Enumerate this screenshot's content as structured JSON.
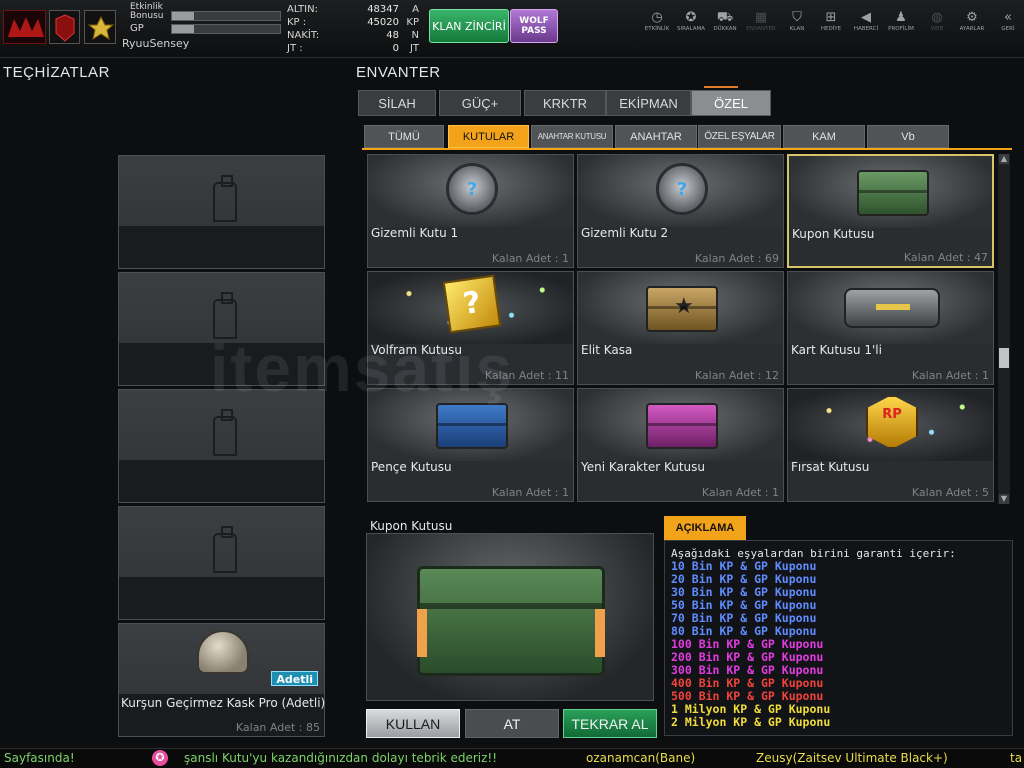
{
  "header": {
    "bonus_label": "Etkinlik Bonusu",
    "gp_label": "GP",
    "username": "RyuuSensey",
    "bonus_progress": 0.2,
    "gp_progress": 0.2,
    "currencies": [
      {
        "label": "ALTIN:",
        "value": "48347",
        "unit": "A"
      },
      {
        "label": "KP   :",
        "value": "45020",
        "unit": "KP"
      },
      {
        "label": "NAKİT:",
        "value": "48",
        "unit": "N"
      },
      {
        "label": "JT   :",
        "value": "0",
        "unit": "JT"
      }
    ],
    "klan_button": "KLAN ZİNCİRİ",
    "wolf_button": "WOLF PASS",
    "nav": [
      {
        "label": "ETKİNLİK",
        "icon": "clock-icon",
        "glyph": "◷"
      },
      {
        "label": "SIRALAMA",
        "icon": "medal-icon",
        "glyph": "✪"
      },
      {
        "label": "DÜKKAN",
        "icon": "cart-icon",
        "glyph": "⛟"
      },
      {
        "label": "ENVANTER",
        "icon": "inventory-icon",
        "glyph": "▦",
        "dim": true
      },
      {
        "label": "KLAN",
        "icon": "shield-icon",
        "glyph": "⛉"
      },
      {
        "label": "HEDİYE",
        "icon": "gift-icon",
        "glyph": "⊞"
      },
      {
        "label": "HABERCİ",
        "icon": "megaphone-icon",
        "glyph": "◀"
      },
      {
        "label": "PROFİLİM",
        "icon": "profile-icon",
        "glyph": "♟"
      },
      {
        "label": "WEB",
        "icon": "globe-icon",
        "glyph": "◍",
        "dim": true
      },
      {
        "label": "AYARLAR",
        "icon": "gear-icon",
        "glyph": "⚙"
      },
      {
        "label": "GERİ",
        "icon": "back-icon",
        "glyph": "«"
      }
    ]
  },
  "left": {
    "title": "TEÇHİZATLAR",
    "slots": [
      {
        "name": "",
        "count": ""
      },
      {
        "name": "",
        "count": ""
      },
      {
        "name": "",
        "count": ""
      },
      {
        "name": "",
        "count": ""
      },
      {
        "name": "Kurşun Geçirmez Kask Pro (Adetli)",
        "count": "Kalan Adet : 85",
        "badge": "Adetli"
      }
    ]
  },
  "inventory": {
    "title": "ENVANTER",
    "tabs": [
      "SİLAH",
      "GÜÇ+",
      "KRKTR",
      "EKİPMAN",
      "ÖZEL"
    ],
    "active_tab": 4,
    "subtabs": [
      "TÜMÜ",
      "KUTULAR",
      "ANAHTAR KUTUSU",
      "ANAHTAR",
      "ÖZEL EŞYALAR",
      "KAM",
      "Vb"
    ],
    "active_subtab": 1,
    "items": [
      {
        "name": "Gizemli Kutu 1",
        "count": "Kalan Adet : 1"
      },
      {
        "name": "Gizemli Kutu 2",
        "count": "Kalan Adet : 69"
      },
      {
        "name": "Kupon Kutusu",
        "count": "Kalan Adet : 47"
      },
      {
        "name": "Volfram Kutusu",
        "count": "Kalan Adet : 11"
      },
      {
        "name": "Elit Kasa",
        "count": "Kalan Adet : 12"
      },
      {
        "name": "Kart Kutusu 1'li",
        "count": "Kalan Adet : 1"
      },
      {
        "name": "Pençe Kutusu",
        "count": "Kalan Adet : 1"
      },
      {
        "name": "Yeni Karakter Kutusu",
        "count": "Kalan Adet : 1"
      },
      {
        "name": "Fırsat Kutusu",
        "count": "Kalan Adet : 5"
      }
    ],
    "selected_index": 2
  },
  "detail": {
    "title": "Kupon Kutusu",
    "use_button": "KULLAN",
    "drop_button": "AT",
    "repeat_button": "TEKRAR AL",
    "desc_header": "AÇIKLAMA",
    "desc_intro": "Aşağıdaki eşyalardan birini garanti içerir:",
    "desc_lines": [
      {
        "text": "10 Bin KP & GP Kuponu",
        "color": "#5f8cff"
      },
      {
        "text": "20 Bin KP & GP Kuponu",
        "color": "#5f8cff"
      },
      {
        "text": "30 Bin KP & GP Kuponu",
        "color": "#5f8cff"
      },
      {
        "text": "50 Bin KP & GP Kuponu",
        "color": "#5f8cff"
      },
      {
        "text": "70 Bin KP & GP Kuponu",
        "color": "#5f8cff"
      },
      {
        "text": "80 Bin KP & GP Kuponu",
        "color": "#5f8cff"
      },
      {
        "text": "100 Bin KP & GP Kuponu",
        "color": "#e23ce0"
      },
      {
        "text": "200 Bin KP & GP Kuponu",
        "color": "#e23ce0"
      },
      {
        "text": "300 Bin KP & GP Kuponu",
        "color": "#e23ce0"
      },
      {
        "text": "400 Bin KP & GP Kuponu",
        "color": "#f0443a"
      },
      {
        "text": "500 Bin KP & GP Kuponu",
        "color": "#f0443a"
      },
      {
        "text": "1 Milyon KP & GP Kuponu",
        "color": "#f1dd3a"
      },
      {
        "text": "2 Milyon KP & GP Kuponu",
        "color": "#f1dd3a"
      }
    ]
  },
  "ticker": {
    "prefix": "Sayfasında!",
    "message": "şanslı Kutu'yu kazandığınızdan dolayı tebrik ederiz!!",
    "user1": "ozanamcan(Bane)",
    "user2": "Zeusy(Zaitsev Ultimate Black+)",
    "tail": "ta"
  },
  "watermark": "itemsatış"
}
